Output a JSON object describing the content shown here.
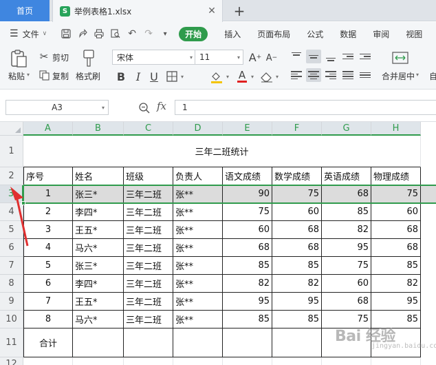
{
  "tabs": {
    "home": "首页",
    "file": "举例表格1.xlsx",
    "file_badge": "S"
  },
  "menu": {
    "file": "文件",
    "start": "开始",
    "items": [
      "插入",
      "页面布局",
      "公式",
      "数据",
      "审阅",
      "视图"
    ]
  },
  "ribbon": {
    "paste": "粘贴",
    "cut": "剪切",
    "copy": "复制",
    "format_painter": "格式刷",
    "font_name": "宋体",
    "font_size": "11",
    "merge_center": "合并居中",
    "bold": "B",
    "italic": "I",
    "underline": "U",
    "font_color_glyph": "A",
    "grow_font": "A",
    "shrink_font": "A",
    "auto": "自"
  },
  "formula_bar": {
    "name_box": "A3",
    "fx": "fx",
    "value": "1"
  },
  "grid": {
    "columns": [
      "A",
      "B",
      "C",
      "D",
      "E",
      "F",
      "G",
      "H"
    ],
    "rows": [
      "1",
      "2",
      "3",
      "4",
      "5",
      "6",
      "7",
      "8",
      "9",
      "10",
      "11",
      "12"
    ],
    "selected_row": "3",
    "title": "三年二班统计",
    "headers": [
      "序号",
      "姓名",
      "班级",
      "负责人",
      "语文成绩",
      "数学成绩",
      "英语成绩",
      "物理成绩"
    ],
    "data": [
      [
        "1",
        "张三*",
        "三年二班",
        "张**",
        "90",
        "75",
        "68",
        "75"
      ],
      [
        "2",
        "李四*",
        "三年二班",
        "张**",
        "75",
        "60",
        "85",
        "60"
      ],
      [
        "3",
        "王五*",
        "三年二班",
        "张**",
        "60",
        "68",
        "82",
        "68"
      ],
      [
        "4",
        "马六*",
        "三年二班",
        "张**",
        "68",
        "68",
        "95",
        "68"
      ],
      [
        "5",
        "张三*",
        "三年二班",
        "张**",
        "85",
        "85",
        "75",
        "85"
      ],
      [
        "6",
        "李四*",
        "三年二班",
        "张**",
        "82",
        "82",
        "60",
        "82"
      ],
      [
        "7",
        "王五*",
        "三年二班",
        "张**",
        "95",
        "95",
        "68",
        "95"
      ],
      [
        "8",
        "马六*",
        "三年二班",
        "张**",
        "85",
        "85",
        "75",
        "85"
      ]
    ],
    "total_label": "合计"
  },
  "watermark": {
    "main": "Bai 经验",
    "sub": "jingyan.baidu.com"
  },
  "colors": {
    "accent_green": "#2f9b4c",
    "tab_blue": "#3f86e0",
    "annotation_red": "#e03030"
  }
}
